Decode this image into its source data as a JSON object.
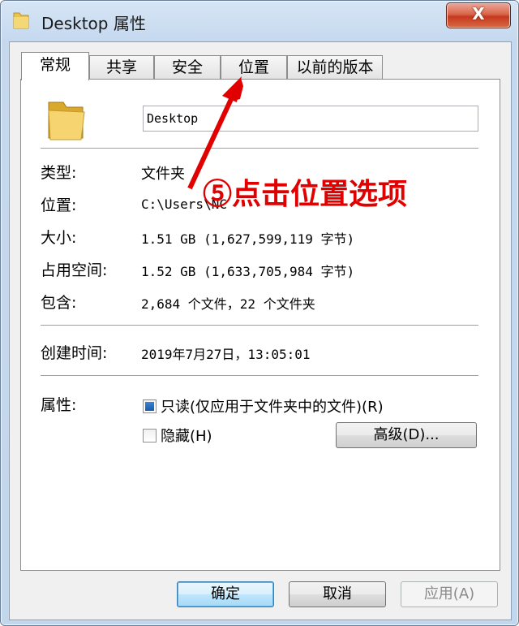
{
  "window": {
    "title": "Desktop 属性",
    "close_label": "X"
  },
  "tabs": [
    {
      "label": "常规",
      "active": true
    },
    {
      "label": "共享",
      "active": false
    },
    {
      "label": "安全",
      "active": false
    },
    {
      "label": "位置",
      "active": false
    },
    {
      "label": "以前的版本",
      "active": false
    }
  ],
  "general": {
    "folder_name": "Desktop",
    "rows": [
      {
        "label": "类型:",
        "value": "文件夹"
      },
      {
        "label": "位置:",
        "value": "C:\\Users\\NC"
      },
      {
        "label": "大小:",
        "value": "1.51 GB (1,627,599,119 字节)"
      },
      {
        "label": "占用空间:",
        "value": "1.52 GB (1,633,705,984 字节)"
      },
      {
        "label": "包含:",
        "value": "2,684 个文件，22 个文件夹"
      }
    ],
    "created_label": "创建时间:",
    "created_value": "2019年7月27日，13:05:01",
    "attributes_label": "属性:",
    "readonly_label": "只读(仅应用于文件夹中的文件)(R)",
    "readonly_checked": true,
    "hidden_label": "隐藏(H)",
    "hidden_checked": false,
    "advanced_label": "高级(D)..."
  },
  "footer": {
    "ok_label": "确定",
    "cancel_label": "取消",
    "apply_label": "应用(A)"
  },
  "annotation": {
    "text": "⑤点击位置选项",
    "color": "#e00000"
  }
}
